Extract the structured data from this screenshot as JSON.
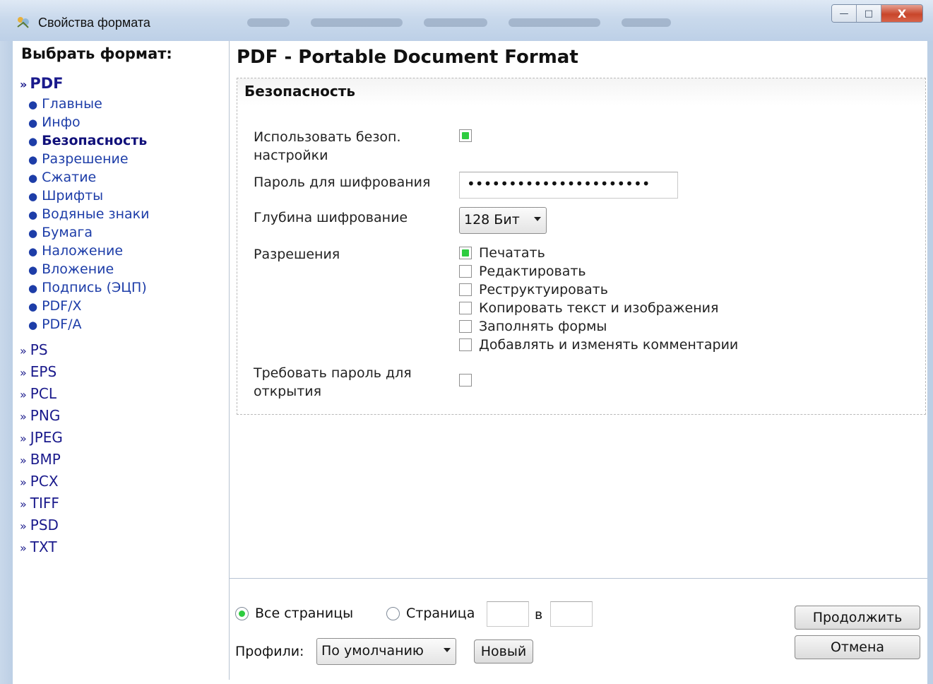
{
  "window": {
    "title": "Свойства формата",
    "minimize": "—",
    "maximize": "□",
    "close": "X"
  },
  "sidebar": {
    "header": "Выбрать формат:",
    "group": {
      "label": "PDF",
      "items": [
        {
          "label": "Главные"
        },
        {
          "label": "Инфо"
        },
        {
          "label": "Безопасность",
          "active": true
        },
        {
          "label": "Разрешение"
        },
        {
          "label": "Сжатие"
        },
        {
          "label": "Шрифты"
        },
        {
          "label": "Водяные знаки"
        },
        {
          "label": "Бумага"
        },
        {
          "label": "Наложение"
        },
        {
          "label": "Вложение"
        },
        {
          "label": "Подпись (ЭЦП)"
        },
        {
          "label": "PDF/X"
        },
        {
          "label": "PDF/A"
        }
      ]
    },
    "formats": [
      "PS",
      "EPS",
      "PCL",
      "PNG",
      "JPEG",
      "BMP",
      "PCX",
      "TIFF",
      "PSD",
      "TXT"
    ]
  },
  "main": {
    "title": "PDF - Portable Document Format",
    "section_title": "Безопасность",
    "use_security_label": "Использовать безоп. настройки",
    "use_security_checked": true,
    "password_label": "Пароль для шифрования",
    "password_value": "••••••••••••••••••••••",
    "depth_label": "Глубина шифрование",
    "depth_value": "128 Бит",
    "permissions_label": "Разрешения",
    "permissions": [
      {
        "label": "Печатать",
        "checked": true
      },
      {
        "label": "Редактировать",
        "checked": false
      },
      {
        "label": "Реструктуировать",
        "checked": false
      },
      {
        "label": "Копировать текст и изображения",
        "checked": false
      },
      {
        "label": "Заполнять формы",
        "checked": false
      },
      {
        "label": "Добавлять и изменять комментарии",
        "checked": false
      }
    ],
    "require_password_label": "Требовать пароль для открытия",
    "require_password_checked": false
  },
  "bottom": {
    "all_pages_label": "Все страницы",
    "page_label": "Страница",
    "to_label": "в",
    "page_from": "",
    "page_to": "",
    "profiles_label": "Профили:",
    "profile_value": "По умолчанию",
    "new_button": "Новый",
    "continue_button": "Продолжить",
    "cancel_button": "Отмена"
  },
  "colors": {
    "accent_green": "#2ecc40",
    "link_blue": "#1d3da8"
  }
}
